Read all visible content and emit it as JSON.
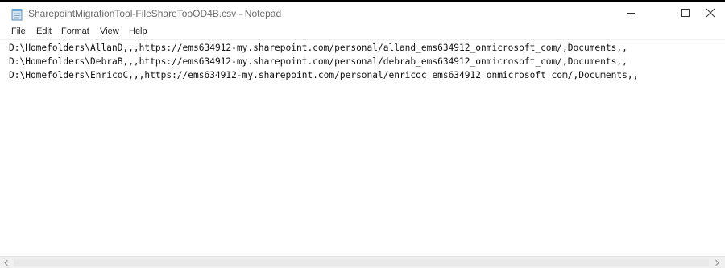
{
  "window": {
    "title": "SharepointMigrationTool-FileShareTooOD4B.csv - Notepad"
  },
  "menu": {
    "items": [
      {
        "label": "File"
      },
      {
        "label": "Edit"
      },
      {
        "label": "Format"
      },
      {
        "label": "View"
      },
      {
        "label": "Help"
      }
    ]
  },
  "editor": {
    "lines": [
      "D:\\Homefolders\\AllanD,,,https://ems634912-my.sharepoint.com/personal/alland_ems634912_onmicrosoft_com/,Documents,,",
      "D:\\Homefolders\\DebraB,,,https://ems634912-my.sharepoint.com/personal/debrab_ems634912_onmicrosoft_com/,Documents,,",
      "D:\\Homefolders\\EnricoC,,,https://ems634912-my.sharepoint.com/personal/enricoc_ems634912_onmicrosoft_com/,Documents,,"
    ]
  },
  "icons": {
    "app": "notepad-icon",
    "minimize": "minimize-icon",
    "maximize": "maximize-icon",
    "close": "close-icon",
    "scroll_left": "chevron-left-icon",
    "scroll_right": "chevron-right-icon"
  },
  "colors": {
    "title_text": "#6b6b6b",
    "text": "#111111",
    "scrollbar": "#f0f0f0"
  }
}
